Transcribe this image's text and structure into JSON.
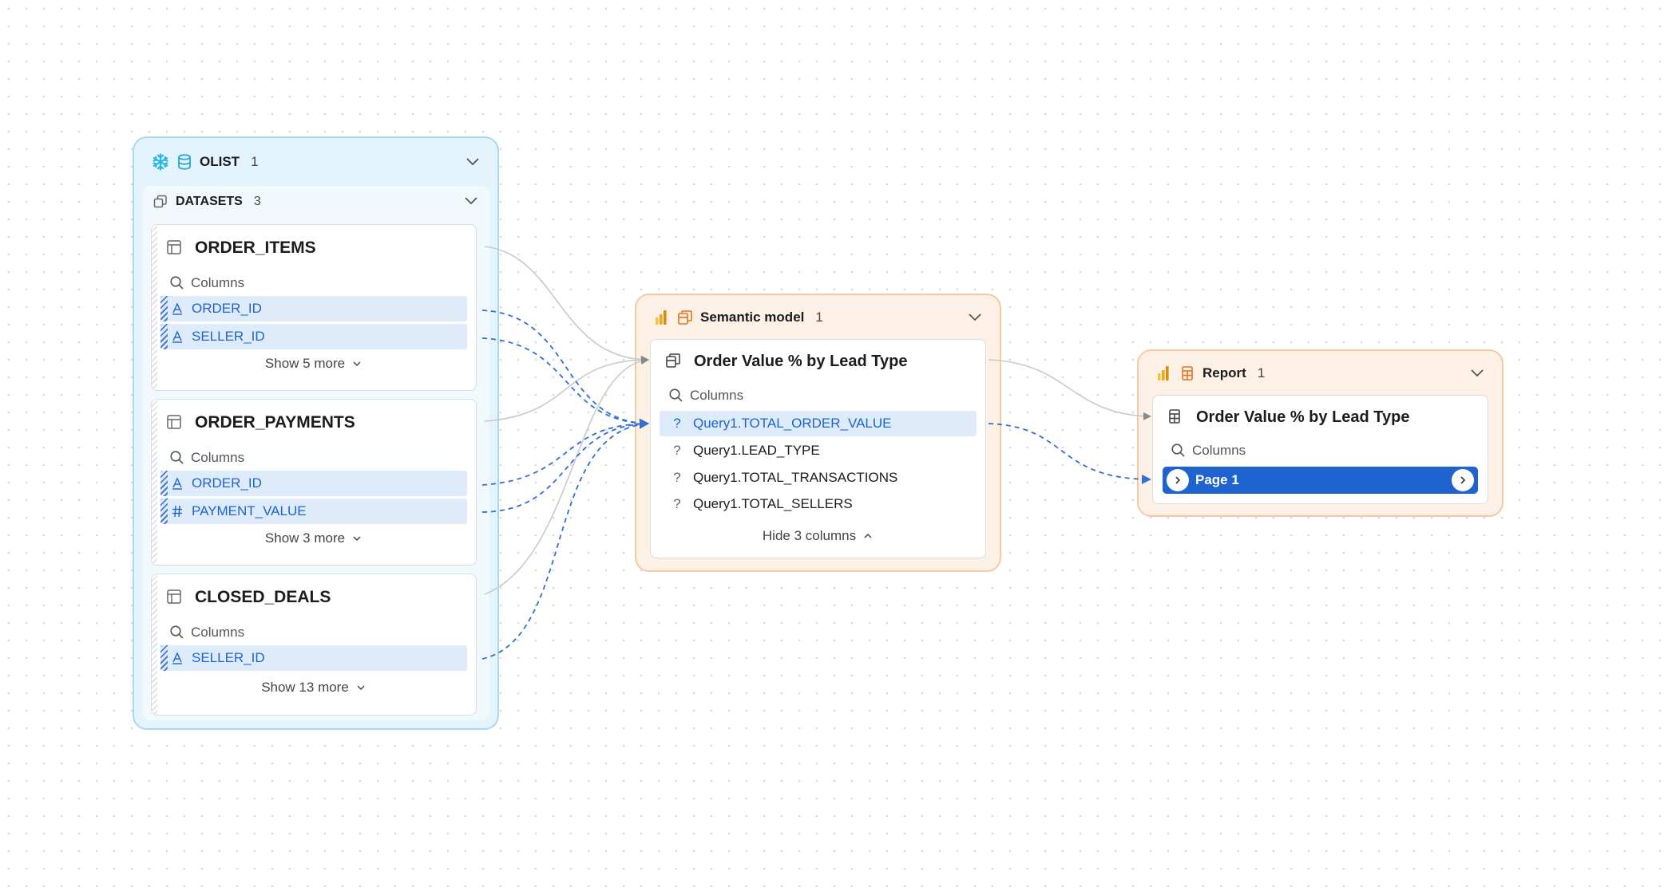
{
  "colors": {
    "warehouse_group": "#e4f4fc",
    "powerbi_group": "#fdf0e5",
    "selected_row": "#deebfb",
    "selected_page": "#1f63d1",
    "lineage_edge": "#3a78d8"
  },
  "source": {
    "name": "OLIST",
    "count": "1",
    "icons": [
      "snowflake-icon",
      "database-icon"
    ],
    "datasets_label": "DATASETS",
    "datasets_count": "3"
  },
  "tables": [
    {
      "name": "ORDER_ITEMS",
      "search_placeholder": "Columns",
      "columns": [
        {
          "name": "ORDER_ID",
          "type": "text"
        },
        {
          "name": "SELLER_ID",
          "type": "text"
        }
      ],
      "more_label": "Show 5 more"
    },
    {
      "name": "ORDER_PAYMENTS",
      "search_placeholder": "Columns",
      "columns": [
        {
          "name": "ORDER_ID",
          "type": "text"
        },
        {
          "name": "PAYMENT_VALUE",
          "type": "number"
        }
      ],
      "more_label": "Show 3 more"
    },
    {
      "name": "CLOSED_DEALS",
      "search_placeholder": "Columns",
      "columns": [
        {
          "name": "SELLER_ID",
          "type": "text"
        }
      ],
      "more_label": "Show 13 more"
    }
  ],
  "semantic_model": {
    "group_label": "Semantic model",
    "count": "1",
    "title": "Order Value % by Lead Type",
    "search_placeholder": "Columns",
    "fields": [
      {
        "name": "Query1.TOTAL_ORDER_VALUE",
        "selected": true
      },
      {
        "name": "Query1.LEAD_TYPE",
        "selected": false
      },
      {
        "name": "Query1.TOTAL_TRANSACTIONS",
        "selected": false
      },
      {
        "name": "Query1.TOTAL_SELLERS",
        "selected": false
      }
    ],
    "hide_label": "Hide 3 columns"
  },
  "report": {
    "group_label": "Report",
    "count": "1",
    "title": "Order Value % by Lead Type",
    "search_placeholder": "Columns",
    "page_label": "Page 1"
  }
}
